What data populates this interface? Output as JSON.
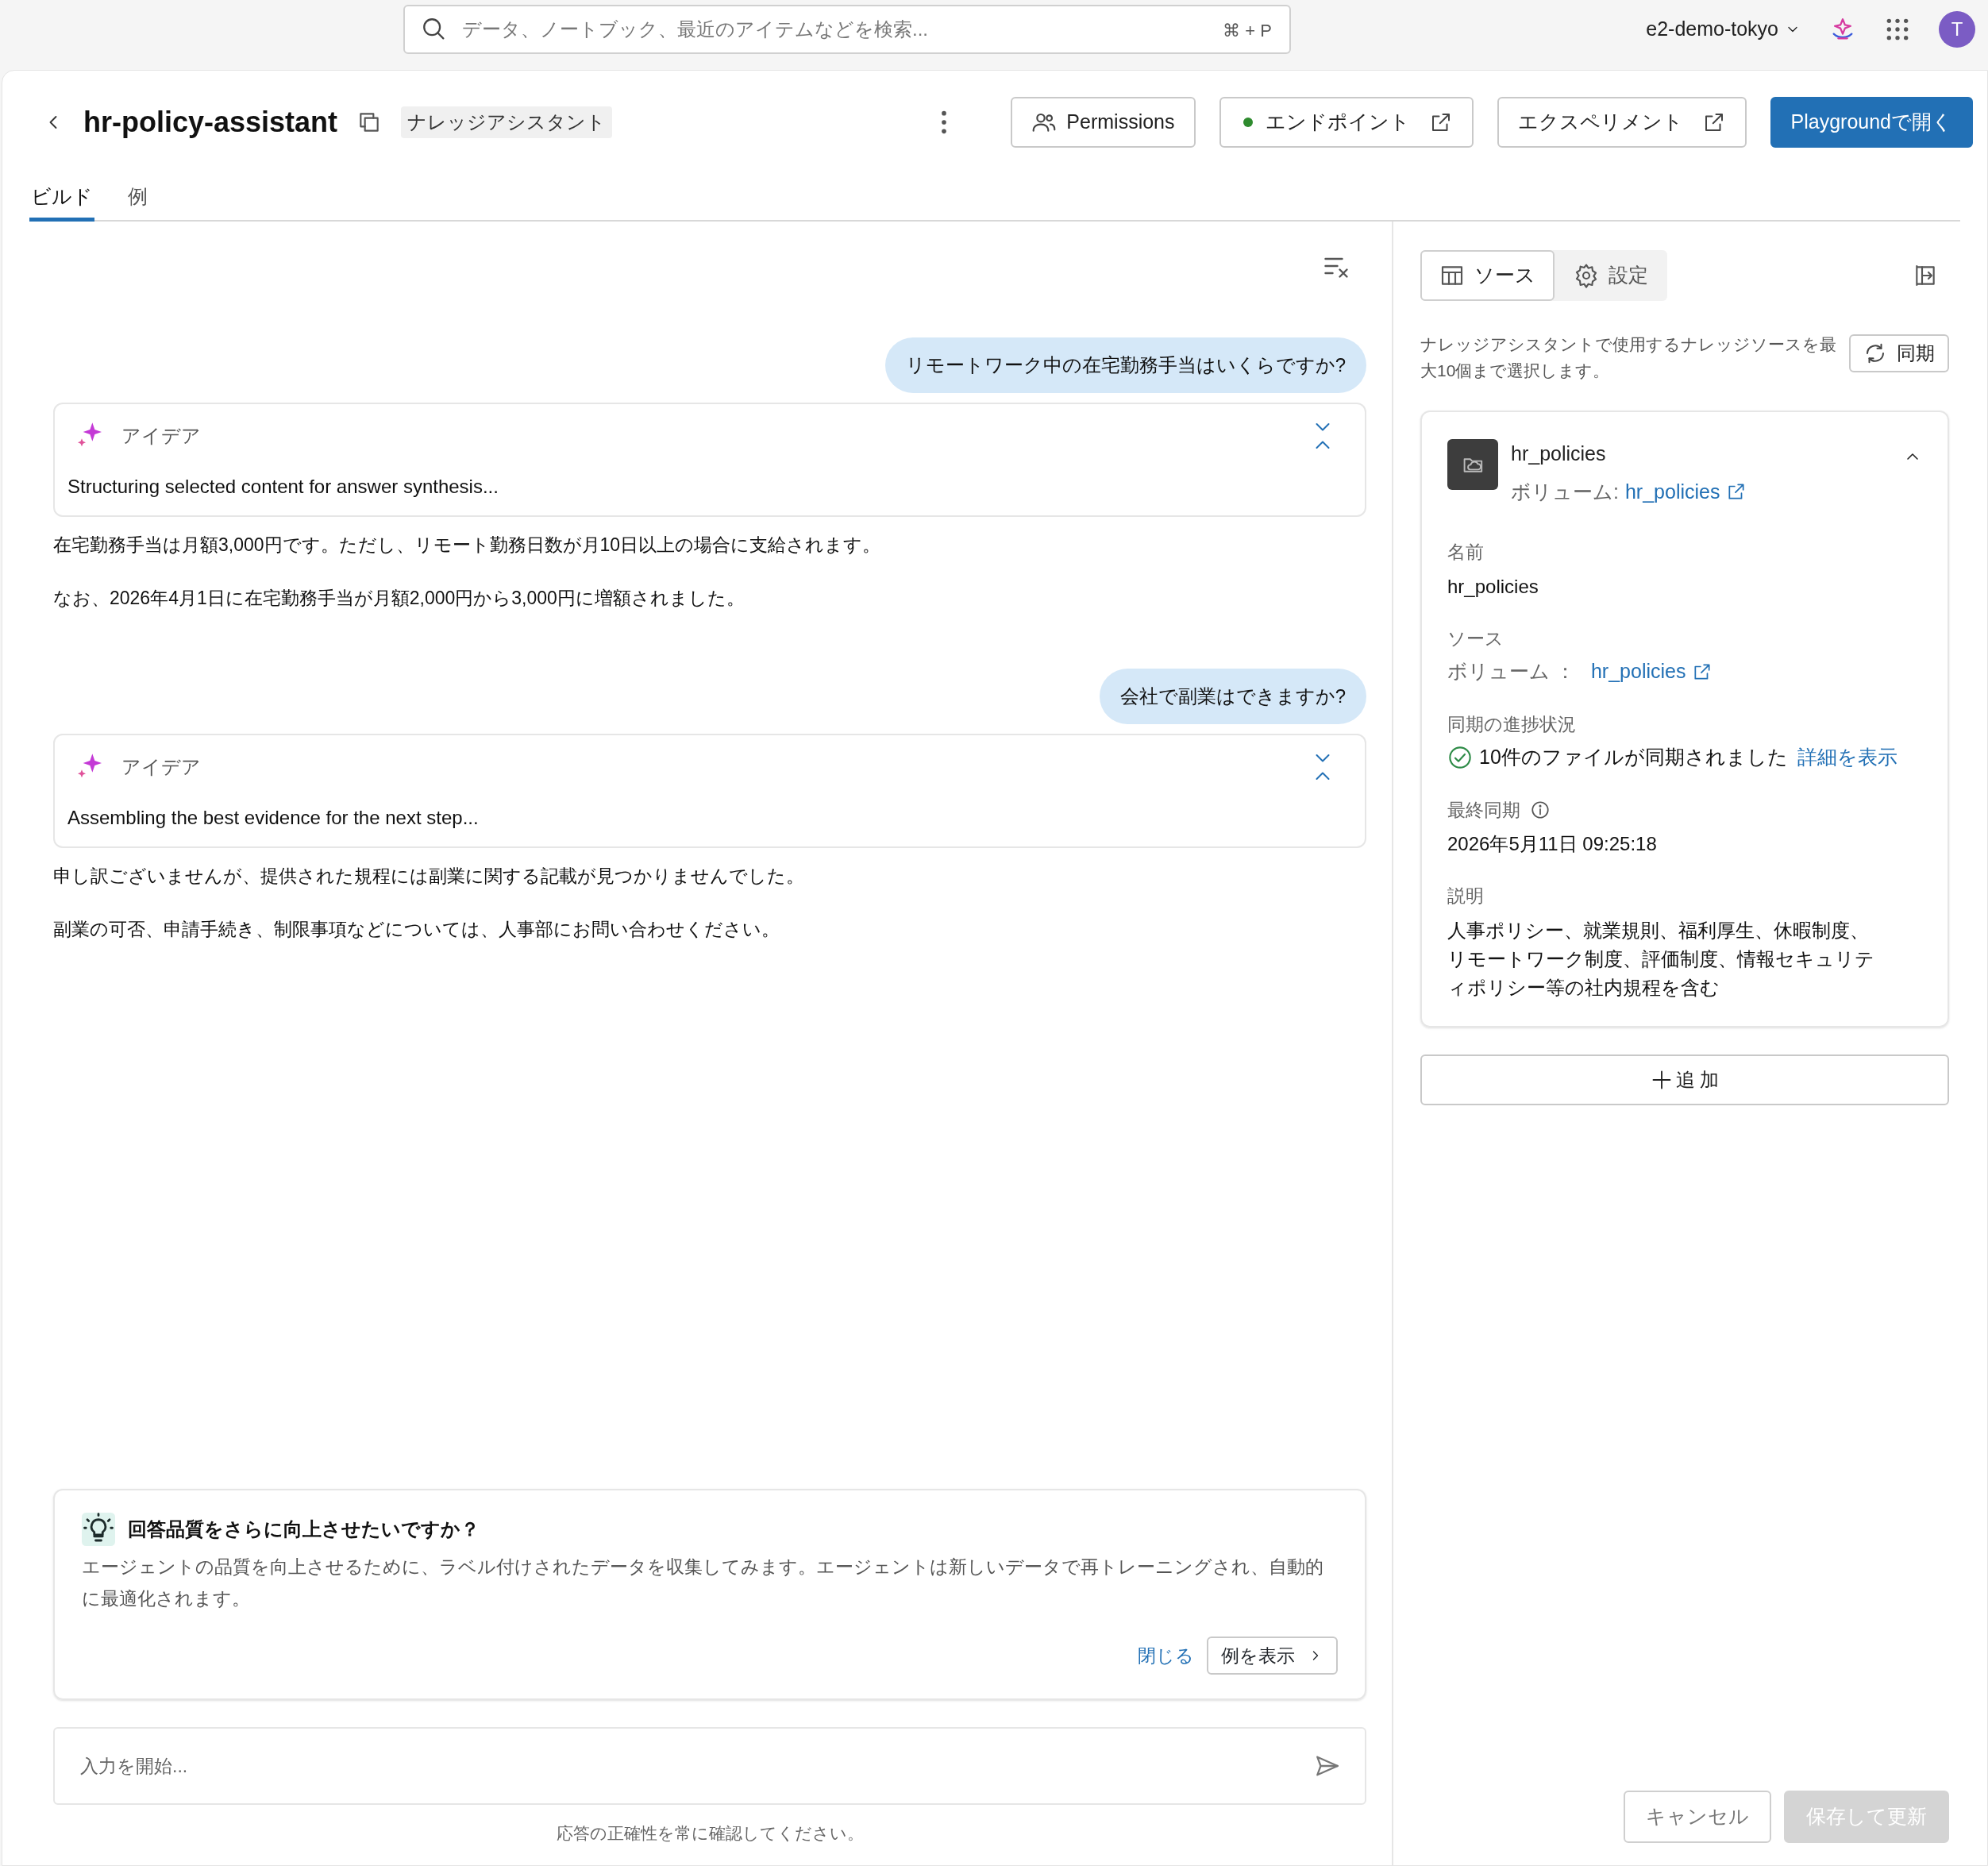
{
  "topbar": {
    "search_placeholder": "データ、ノートブック、最近のアイテムなどを検索...",
    "shortcut": "⌘ + P",
    "workspace": "e2-demo-tokyo",
    "avatar": "T"
  },
  "header": {
    "title": "hr-policy-assistant",
    "badge": "ナレッジアシスタント",
    "buttons": [
      {
        "label": "Permissions",
        "kind": "permissions"
      },
      {
        "label": "エンドポイント",
        "kind": "endpoint"
      },
      {
        "label": "エクスペリメント",
        "kind": "external"
      },
      {
        "label": "Playgroundで開く",
        "kind": "primary"
      }
    ]
  },
  "tabs": [
    {
      "label": "ビルド",
      "selected": true
    },
    {
      "label": "例",
      "selected": false
    }
  ],
  "chat": {
    "messages": [
      {
        "kind": "user",
        "text": "リモートワーク中の在宅勤務手当はいくらですか?"
      },
      {
        "kind": "thought",
        "label": "アイデア",
        "expanded": true,
        "text": "Structuring selected content for answer synthesis..."
      },
      {
        "kind": "answer",
        "paragraphs": [
          "在宅勤務手当は月額3,000円です。ただし、リモート勤務日数が月10日以上の場合に支給されます。",
          "なお、2026年4月1日に在宅勤務手当が月額2,000円から3,000円に増額されました。"
        ]
      },
      {
        "kind": "user",
        "text": "会社で副業はできますか?"
      },
      {
        "kind": "thought",
        "label": "アイデア",
        "expanded": true,
        "text": "Assembling the best evidence for the next step..."
      },
      {
        "kind": "answer",
        "paragraphs": [
          "申し訳ございませんが、提供された規程には副業に関する記載が見つかりませんでした。",
          "副業の可否、申請手続き、制限事項などについては、人事部にお問い合わせください。"
        ]
      }
    ]
  },
  "suggestion": {
    "title": "回答品質をさらに向上させたいですか？",
    "body": "エージェントの品質を向上させるために、ラベル付けされたデータを収集してみます。エージェントは新しいデータで再トレーニングされ、自動的に最適化されます。",
    "dismiss": "閉じる",
    "action": "例を表示"
  },
  "input": {
    "placeholder": "入力を開始..."
  },
  "disclaimer": "応答の正確性を常に確認してください。",
  "panel": {
    "tabs": [
      {
        "label": "ソース",
        "kind": "table",
        "selected": true
      },
      {
        "label": "設定",
        "kind": "gear",
        "selected": false
      }
    ],
    "description": "ナレッジアシスタントで使用するナレッジソースを最大10個まで選択します。",
    "sync_button": "同期",
    "source": {
      "name": "hr_policies",
      "volume_label": "ボリューム:",
      "volume_link": "hr_policies",
      "expanded": true,
      "fields": [
        {
          "kind": "text",
          "label": "名前",
          "value": "hr_policies"
        },
        {
          "kind": "link",
          "label": "ソース",
          "volume_label": "ボリューム ：",
          "volume_link": "hr_policies"
        },
        {
          "kind": "status",
          "label": "同期の進捗状況",
          "value": "10件のファイルが同期されました",
          "link": "詳細を表示"
        },
        {
          "kind": "info",
          "label": "最終同期",
          "value": "2026年5月11日 09:25:18"
        },
        {
          "kind": "text",
          "label": "説明",
          "value": "人事ポリシー、就業規則、福利厚生、休暇制度、リモートワーク制度、評価制度、情報セキュリティポリシー等の社内規程を含む"
        }
      ]
    },
    "add_button": "追 加",
    "footer": [
      {
        "label": "キャンセル",
        "kind": "secondary",
        "disabled": false
      },
      {
        "label": "保存して更新",
        "kind": "primary",
        "disabled": true
      }
    ]
  }
}
